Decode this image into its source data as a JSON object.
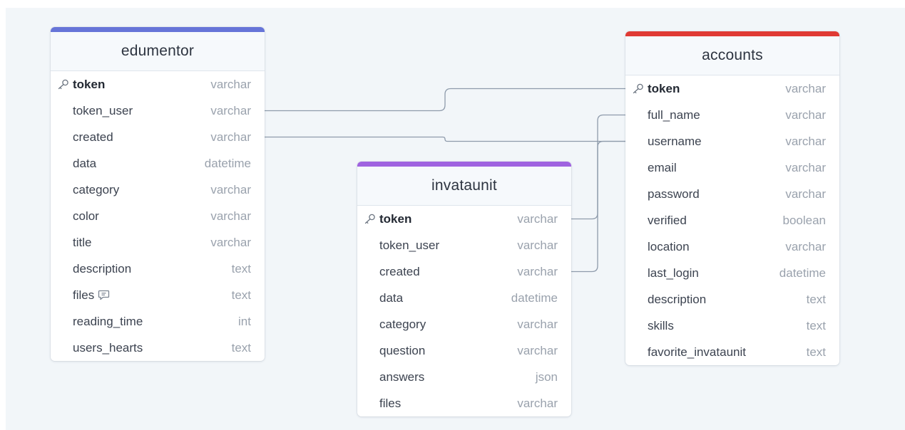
{
  "tables": [
    {
      "name": "edumentor",
      "accent_color": "#6674d8",
      "fields": [
        {
          "name": "token",
          "type": "varchar",
          "pk": true
        },
        {
          "name": "token_user",
          "type": "varchar"
        },
        {
          "name": "created",
          "type": "varchar"
        },
        {
          "name": "data",
          "type": "datetime"
        },
        {
          "name": "category",
          "type": "varchar"
        },
        {
          "name": "color",
          "type": "varchar"
        },
        {
          "name": "title",
          "type": "varchar"
        },
        {
          "name": "description",
          "type": "text"
        },
        {
          "name": "files",
          "type": "text",
          "note": true
        },
        {
          "name": "reading_time",
          "type": "int"
        },
        {
          "name": "users_hearts",
          "type": "text"
        }
      ]
    },
    {
      "name": "invataunit",
      "accent_color": "#9f63e0",
      "fields": [
        {
          "name": "token",
          "type": "varchar",
          "pk": true
        },
        {
          "name": "token_user",
          "type": "varchar"
        },
        {
          "name": "created",
          "type": "varchar"
        },
        {
          "name": "data",
          "type": "datetime"
        },
        {
          "name": "category",
          "type": "varchar"
        },
        {
          "name": "question",
          "type": "varchar"
        },
        {
          "name": "answers",
          "type": "json"
        },
        {
          "name": "files",
          "type": "varchar"
        }
      ]
    },
    {
      "name": "accounts",
      "accent_color": "#e03a34",
      "fields": [
        {
          "name": "token",
          "type": "varchar",
          "pk": true
        },
        {
          "name": "full_name",
          "type": "varchar"
        },
        {
          "name": "username",
          "type": "varchar"
        },
        {
          "name": "email",
          "type": "varchar"
        },
        {
          "name": "password",
          "type": "varchar"
        },
        {
          "name": "verified",
          "type": "boolean"
        },
        {
          "name": "location",
          "type": "varchar"
        },
        {
          "name": "last_login",
          "type": "datetime"
        },
        {
          "name": "description",
          "type": "text"
        },
        {
          "name": "skills",
          "type": "text"
        },
        {
          "name": "favorite_invataunit",
          "type": "text"
        }
      ]
    }
  ],
  "relationships": [
    {
      "from": "edumentor.token_user",
      "to": "accounts.token"
    },
    {
      "from": "edumentor.created",
      "to": "accounts.username"
    },
    {
      "from": "invataunit.token",
      "to": "accounts.full_name"
    },
    {
      "from": "invataunit.created",
      "to": "accounts.username"
    }
  ],
  "colors": {
    "canvas": "#f2f6f9",
    "connector": "#8e9bab"
  }
}
